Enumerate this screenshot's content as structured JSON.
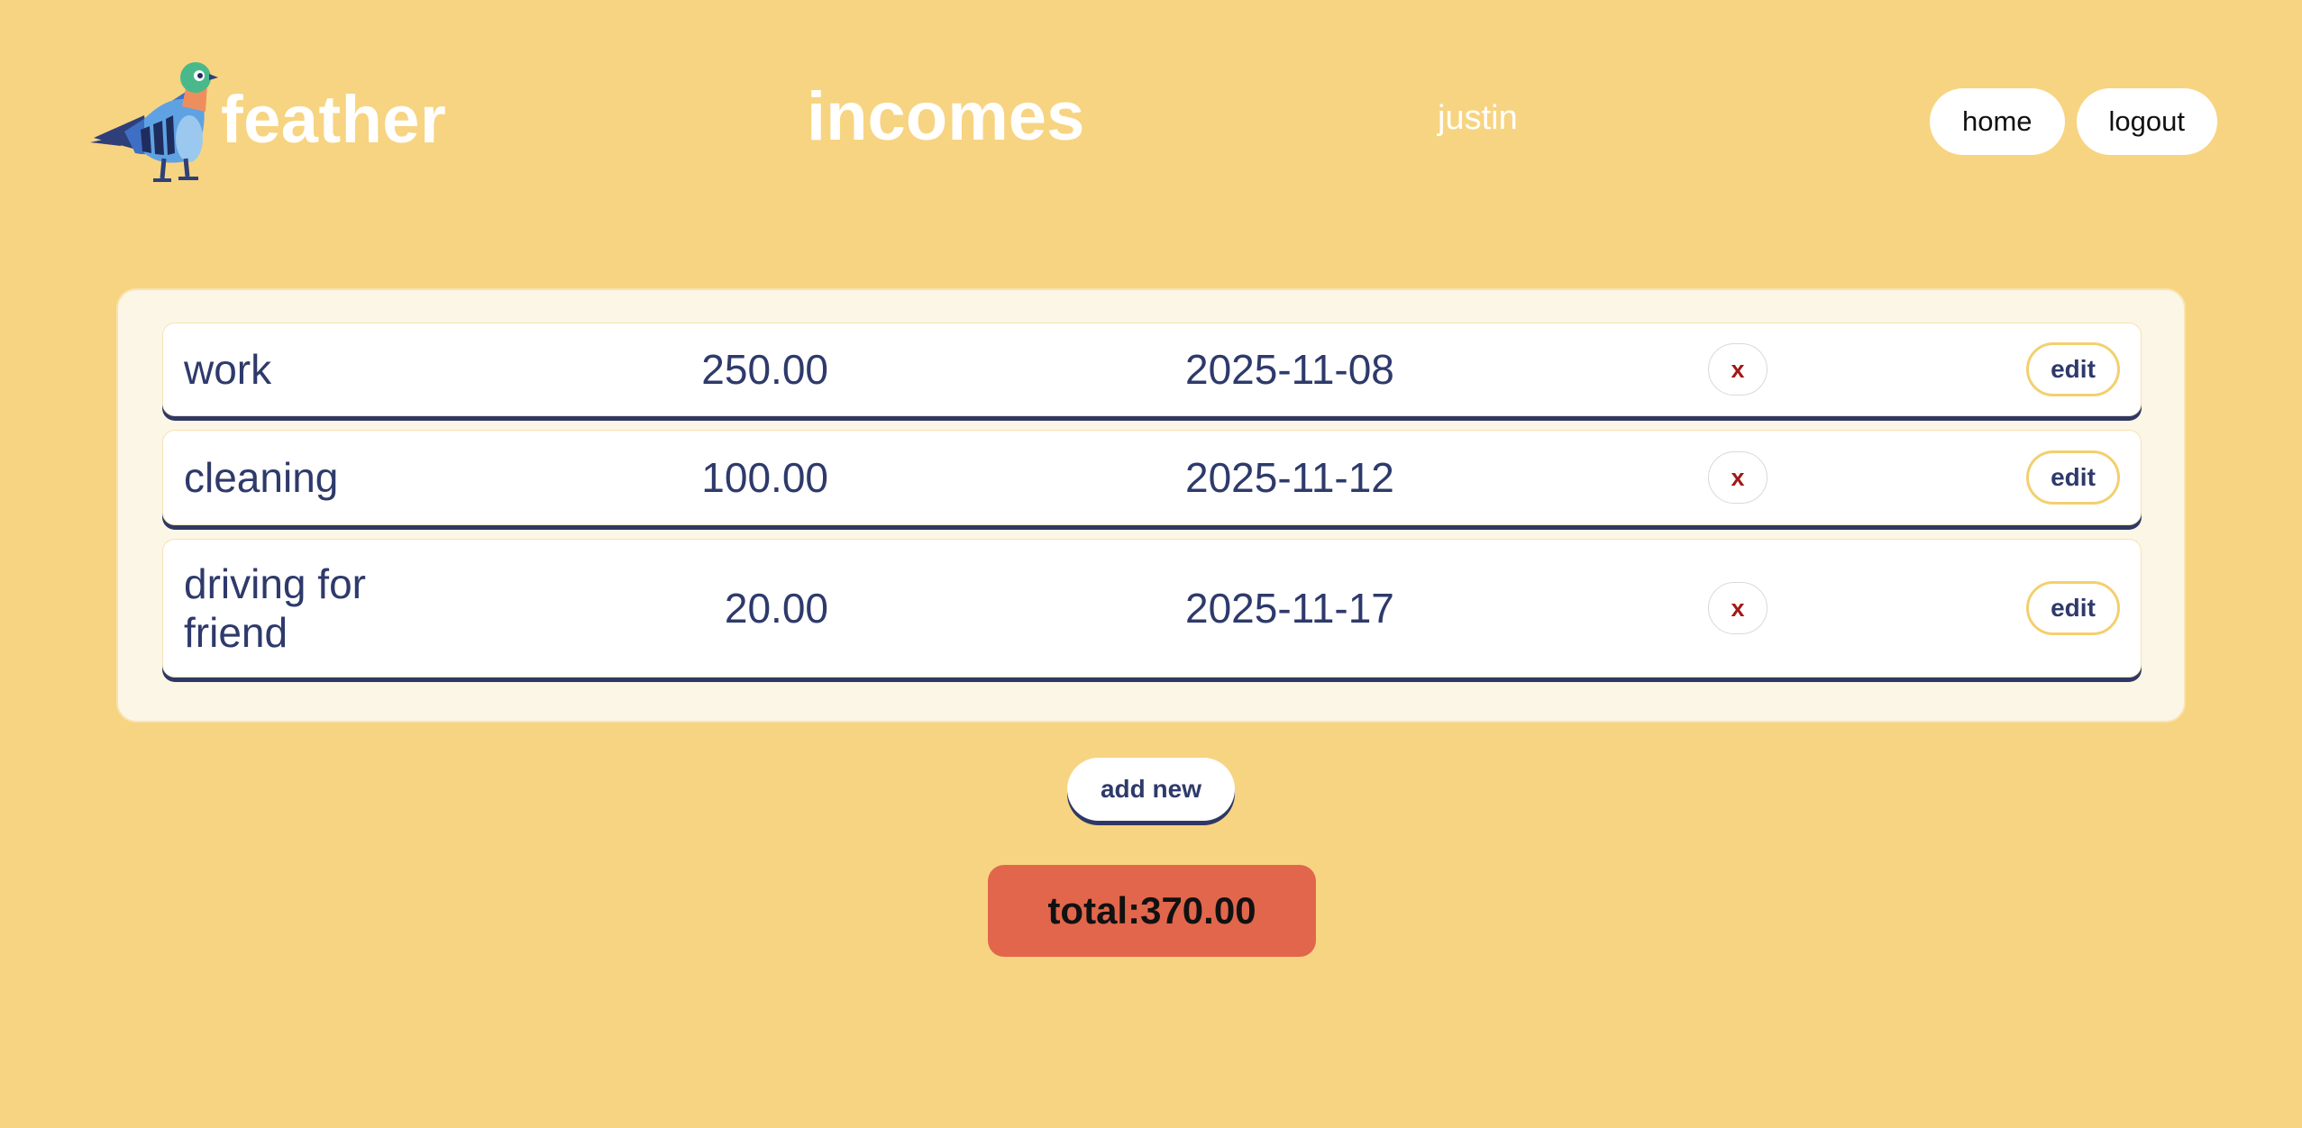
{
  "header": {
    "brand_name": "feather",
    "page_title": "incomes",
    "username": "justin",
    "nav": {
      "home_label": "home",
      "logout_label": "logout"
    }
  },
  "incomes": [
    {
      "name": "work",
      "amount": "250.00",
      "date": "2025-11-08",
      "delete_label": "x",
      "edit_label": "edit"
    },
    {
      "name": "cleaning",
      "amount": "100.00",
      "date": "2025-11-12",
      "delete_label": "x",
      "edit_label": "edit"
    },
    {
      "name": "driving for friend",
      "amount": "20.00",
      "date": "2025-11-17",
      "delete_label": "x",
      "edit_label": "edit"
    }
  ],
  "actions": {
    "add_new_label": "add new"
  },
  "total": {
    "label": "total:",
    "value": "370.00"
  },
  "colors": {
    "background": "#F7D481",
    "panel": "#FCF6E6",
    "text_navy": "#2E3A6B",
    "total_badge": "#E1664C",
    "delete_x": "#A31818",
    "edit_border": "#F3D06E"
  },
  "icons": {
    "logo": "pigeon-logo-icon"
  }
}
